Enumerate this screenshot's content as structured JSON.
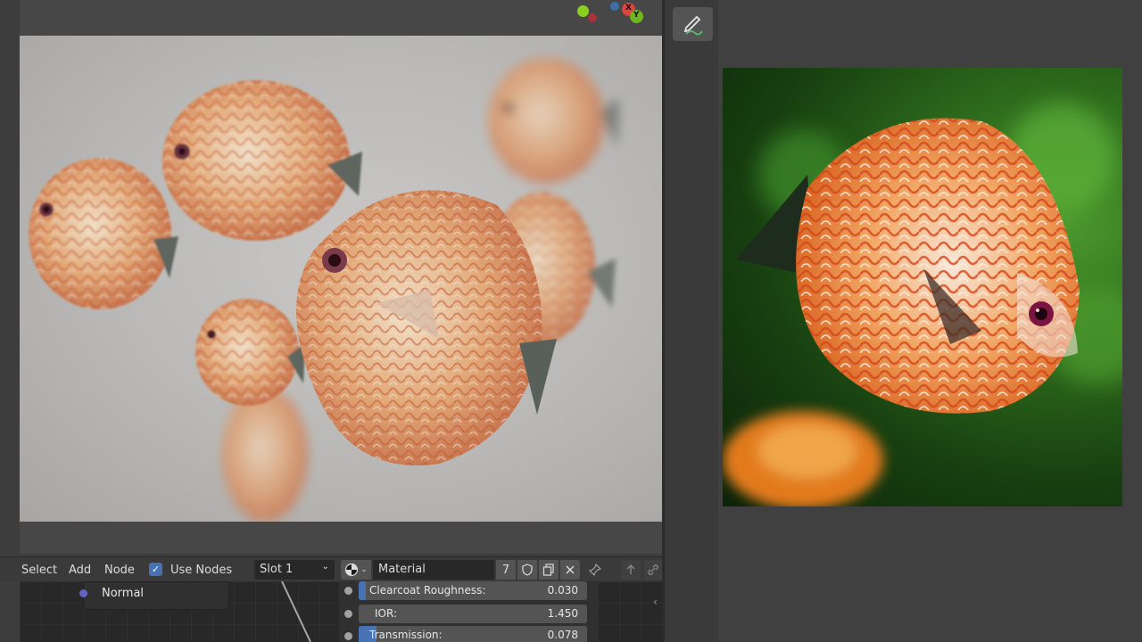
{
  "node_editor": {
    "menu": {
      "select": "Select",
      "add": "Add",
      "node": "Node"
    },
    "use_nodes_label": "Use Nodes",
    "use_nodes_checked": true,
    "slot": "Slot 1",
    "material_name": "Material",
    "user_count": "7",
    "node_output_label": "Normal",
    "properties": [
      {
        "label": "Clearcoat Roughness:",
        "value": "0.030",
        "fill_fraction": 0.03
      },
      {
        "label": "IOR:",
        "value": "1.450",
        "fill_fraction": 0
      },
      {
        "label": "Transmission:",
        "value": "0.078",
        "fill_fraction": 0.078
      }
    ]
  },
  "gizmo": {
    "x_label": "X",
    "y_label": "Y"
  },
  "colors": {
    "accent": "#4772b3",
    "gizmo_x": "#e0443e",
    "gizmo_y": "#6fb51f",
    "gizmo_z": "#2e86f2"
  }
}
